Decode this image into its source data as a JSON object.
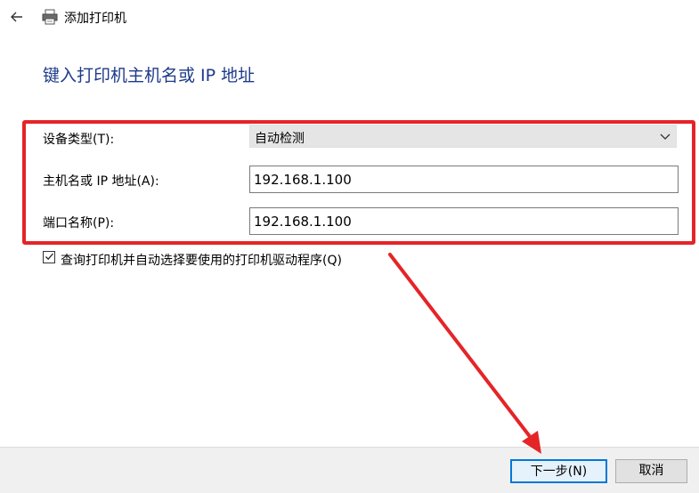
{
  "window": {
    "title": "添加打印机",
    "back_icon": "back-arrow-icon",
    "printer_icon": "printer-icon"
  },
  "page": {
    "heading": "键入打印机主机名或 IP 地址"
  },
  "form": {
    "device_type": {
      "label": "设备类型(T):",
      "value": "自动检测"
    },
    "hostname": {
      "label": "主机名或 IP 地址(A):",
      "value": "192.168.1.100"
    },
    "port_name": {
      "label": "端口名称(P):",
      "value": "192.168.1.100"
    },
    "query_printer": {
      "label": "查询打印机并自动选择要使用的打印机驱动程序(Q)",
      "checked": true
    }
  },
  "buttons": {
    "next": "下一步(N)",
    "cancel": "取消"
  },
  "colors": {
    "accent": "#0078d7",
    "heading": "#1e3a8a",
    "annotation": "#e52428"
  }
}
